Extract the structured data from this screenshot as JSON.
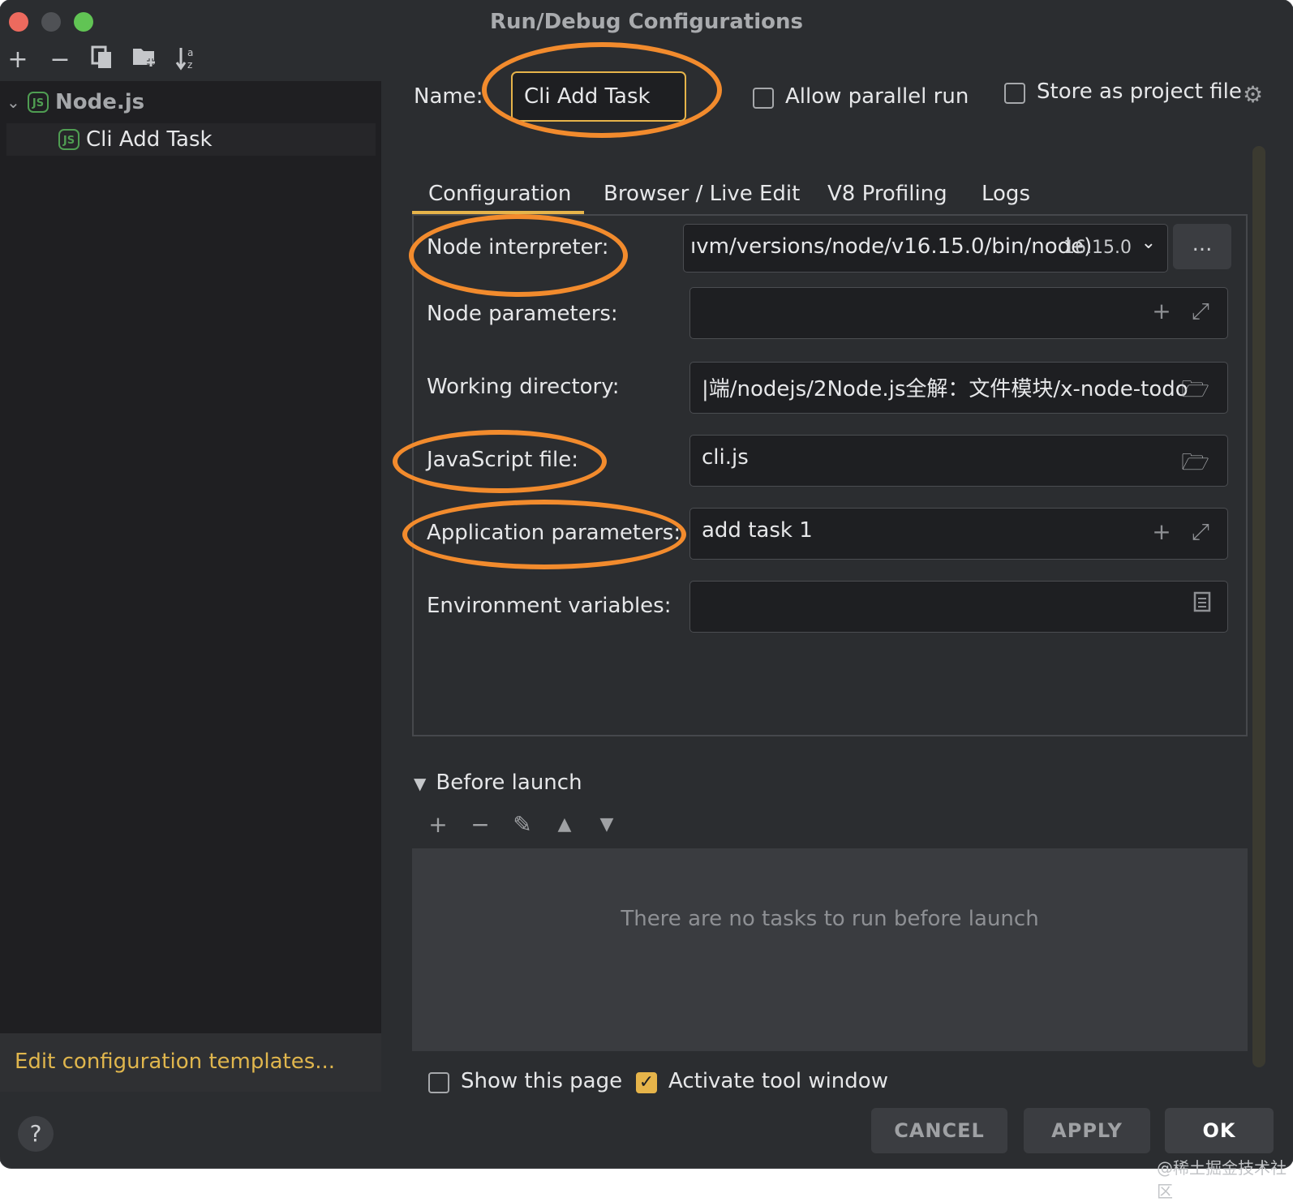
{
  "window": {
    "title": "Run/Debug Configurations"
  },
  "toolbar": {
    "icons": [
      "add-icon",
      "remove-icon",
      "copy-icon",
      "folder-add-icon",
      "sort-alpha-icon"
    ]
  },
  "tree": {
    "root_label": "Node.js",
    "child_label": "Cli Add Task",
    "js_icon_text": "JS"
  },
  "sidebar": {
    "templates_link": "Edit configuration templates..."
  },
  "help_label": "?",
  "form": {
    "name_label": "Name:",
    "name_value": "Cli Add Task",
    "allow_parallel_label": "Allow parallel run",
    "allow_parallel_checked": false,
    "store_project_label": "Store as project file",
    "store_project_checked": false
  },
  "tabs": [
    {
      "label": "Configuration",
      "active": true
    },
    {
      "label": "Browser / Live Edit",
      "active": false
    },
    {
      "label": "V8 Profiling",
      "active": false
    },
    {
      "label": "Logs",
      "active": false
    }
  ],
  "config": {
    "node_interpreter_label": "Node interpreter:",
    "node_interpreter_value": "ıvm/versions/node/v16.15.0/bin/node)",
    "node_interpreter_version": "16.15.0",
    "node_interpreter_browse": "...",
    "node_parameters_label": "Node parameters:",
    "node_parameters_value": "",
    "working_directory_label": "Working directory:",
    "working_directory_value": "|端/nodejs/2Node.js全解：文件模块/x-node-todo",
    "javascript_file_label": "JavaScript file:",
    "javascript_file_value": "cli.js",
    "app_parameters_label": "Application parameters:",
    "app_parameters_value": "add task 1",
    "env_variables_label": "Environment variables:",
    "env_variables_value": ""
  },
  "before_launch": {
    "title": "Before launch",
    "empty_text": "There are no tasks to run before launch",
    "tools": [
      "add-icon",
      "remove-icon",
      "edit-icon",
      "move-up-icon",
      "move-down-icon"
    ]
  },
  "footer": {
    "show_page_label": "Show this page",
    "show_page_checked": false,
    "activate_tool_label": "Activate tool window",
    "activate_tool_checked": true
  },
  "buttons": {
    "cancel": "CANCEL",
    "apply": "APPLY",
    "ok": "OK"
  },
  "watermark": "@稀土掘金技术社区",
  "colors": {
    "accent": "#e6b44a",
    "annotation": "#f28b2d",
    "background": "#2b2d30"
  }
}
